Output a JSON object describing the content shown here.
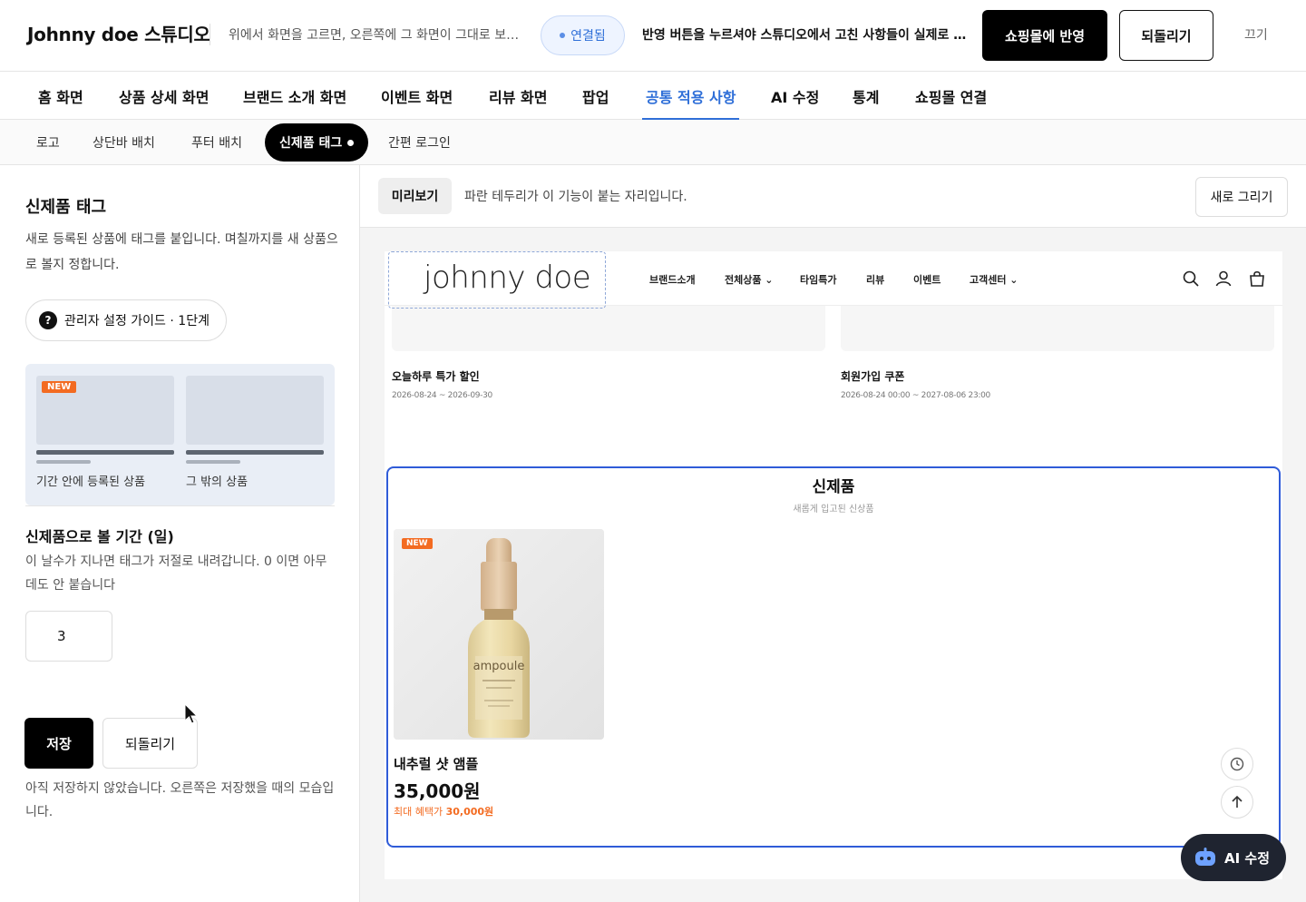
{
  "header": {
    "brand": "Johnny doe 스튜디오",
    "hint": "위에서 화면을 고르면, 오른쪽에 그 화면이 그대로 보입니다",
    "connection_status": "연결됨",
    "publish_hint": "반영 버튼을 누르셔야 스튜디오에서 고친 사항들이 실제로 쇼핑몰에 반영됩니다",
    "publish_label": "쇼핑몰에 반영",
    "revert_label": "되돌리기",
    "off_label": "끄기"
  },
  "tabs": [
    {
      "label": "홈 화면"
    },
    {
      "label": "상품 상세 화면"
    },
    {
      "label": "브랜드 소개 화면"
    },
    {
      "label": "이벤트 화면"
    },
    {
      "label": "리뷰 화면"
    },
    {
      "label": "팝업"
    },
    {
      "label": "공통 적용 사항",
      "active": true
    },
    {
      "label": "AI 수정"
    },
    {
      "label": "통계"
    },
    {
      "label": "쇼핑몰 연결"
    }
  ],
  "subtabs": [
    {
      "label": "로고"
    },
    {
      "label": "상단바 배치"
    },
    {
      "label": "푸터 배치"
    },
    {
      "label": "신제품 태그",
      "active": true
    },
    {
      "label": "간편 로그인"
    }
  ],
  "left": {
    "title": "신제품 태그",
    "desc": "새로 등록된 상품에 태그를 붙입니다. 며칠까지를 새 상품으로 볼지 정합니다.",
    "guide_label": "관리자 설정 가이드 · 1단계",
    "compare": {
      "new_badge": "NEW",
      "label_in": "기간 안에 등록된 상품",
      "label_out": "그 밖의 상품"
    },
    "period_title": "신제품으로 볼 기간 (일)",
    "period_desc": "이 날수가 지나면 태그가 저절로 내려갑니다. 0 이면 아무 데도 안 붙습니다",
    "period_value": "3",
    "save_label": "저장",
    "revert_label": "되돌리기",
    "note": "아직 저장하지 않았습니다. 오른쪽은 저장했을 때의 모습입니다."
  },
  "preview": {
    "label": "미리보기",
    "desc": "파란 테두리가 이 기능이 붙는 자리입니다.",
    "redraw_label": "새로 그리기",
    "site": {
      "logo": "johnny  doe",
      "menu": [
        "브랜드소개",
        "전체상품 ⌄",
        "타임특가",
        "리뷰",
        "이벤트",
        "고객센터 ⌄"
      ],
      "events": [
        {
          "title": "오늘하루 특가 할인",
          "date": "2026-08-24 ~ 2026-09-30"
        },
        {
          "title": "회원가입 쿠폰",
          "date": "2026-08-24 00:00 ~ 2027-08-06 23:00"
        }
      ],
      "new_section": {
        "title": "신제품",
        "subtitle": "새롭게 입고된 신상품",
        "product": {
          "badge": "NEW",
          "bottle_text": "ampoule",
          "name": "내추럴 샷 앰플",
          "price": "35,000원",
          "benefit_label": "최대 혜택가",
          "benefit_price": "30,000원"
        }
      }
    }
  },
  "ai_button_label": "AI 수정",
  "colors": {
    "accent": "#2f6fd8",
    "highlight_border": "#2f5bd8",
    "new_badge": "#f36b21",
    "dark": "#000000"
  }
}
